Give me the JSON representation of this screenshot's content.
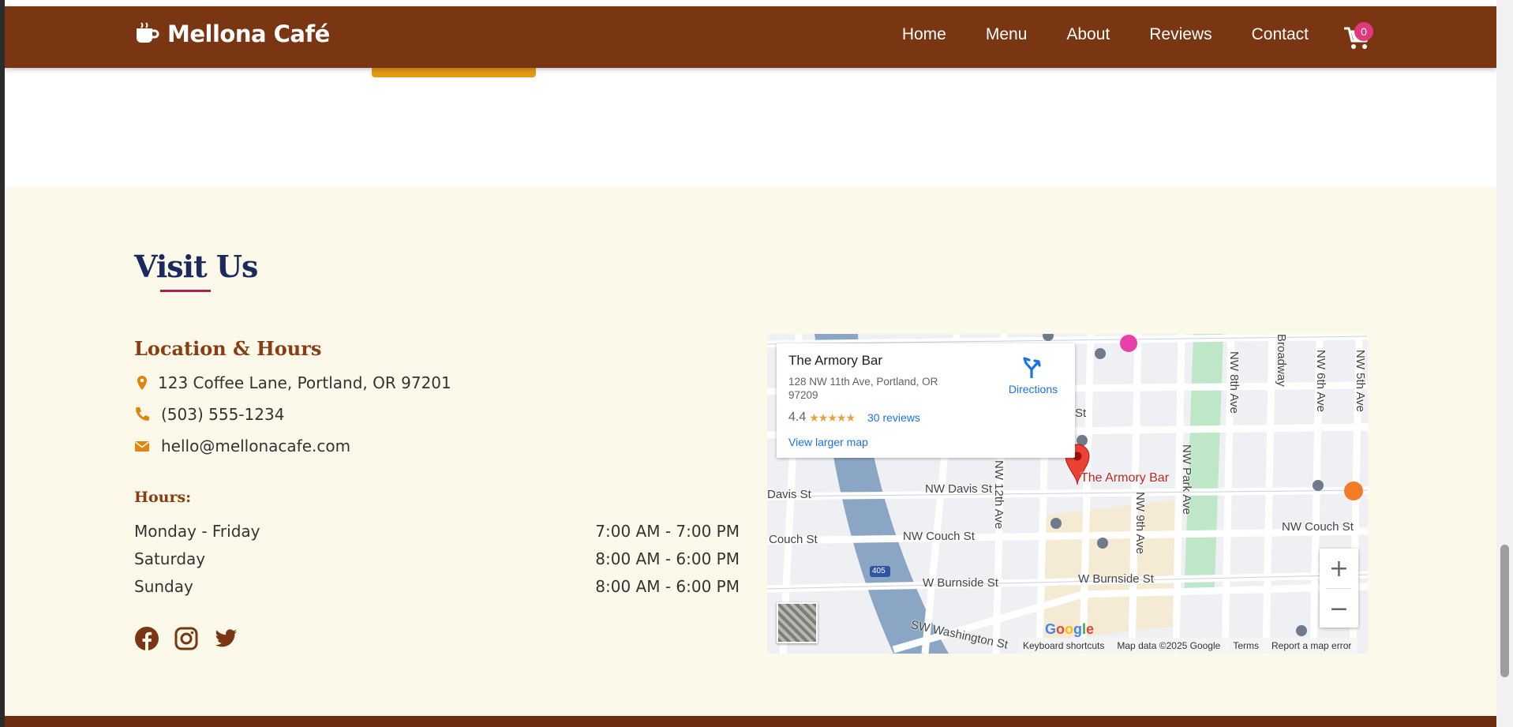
{
  "header": {
    "brand": "Mellona Café",
    "nav": [
      "Home",
      "Menu",
      "About",
      "Reviews",
      "Contact"
    ],
    "cart_count": "0"
  },
  "visit": {
    "title": "Visit Us",
    "subtitle": "Location & Hours",
    "address": "123 Coffee Lane, Portland, OR 97201",
    "phone": "(503) 555-1234",
    "email": "hello@mellonacafe.com",
    "hours_label": "Hours:",
    "hours": [
      {
        "day": "Monday - Friday",
        "time": "7:00 AM - 7:00 PM"
      },
      {
        "day": "Saturday",
        "time": "8:00 AM - 6:00 PM"
      },
      {
        "day": "Sunday",
        "time": "8:00 AM - 6:00 PM"
      }
    ],
    "social": [
      "facebook-icon",
      "instagram-icon",
      "twitter-icon"
    ]
  },
  "map": {
    "place_name": "The Armory Bar",
    "address": "128 NW 11th Ave, Portland, OR 97209",
    "rating": "4.4",
    "stars": "★★★★★",
    "reviews": "30 reviews",
    "directions": "Directions",
    "larger_map": "View larger map",
    "pin_label": "The Armory Bar",
    "streets": {
      "davis_w": "Davis St",
      "davis": "NW Davis St",
      "couch_w": "Couch St",
      "couch": "NW Couch St",
      "couch_e": "NW Couch St",
      "burnside_w": "W Burnside St",
      "burnside": "W Burnside St",
      "washington": "SW Washington St",
      "st_partial": "St",
      "twelfth": "NW 12th Ave",
      "ninth": "NW 9th Ave",
      "park": "NW Park Ave",
      "eighth": "NW 8th Ave",
      "broadway": "Broadway",
      "sixth": "NW 6th Ave",
      "fifth": "NW 5th Ave",
      "highway": "405"
    },
    "google": "Google",
    "attribution": [
      "Keyboard shortcuts",
      "Map data ©2025 Google",
      "Terms",
      "Report a map error"
    ],
    "zoom_in": "+",
    "zoom_out": "−"
  },
  "colors": {
    "header_bg": "#7a3512",
    "accent_orange": "#e59a14",
    "title_navy": "#1b2a5e",
    "subtitle_brown": "#8a3c12",
    "underline_pink": "#b0204d",
    "section_bg": "#fdf9ea",
    "icon_orange": "#e0860e"
  }
}
